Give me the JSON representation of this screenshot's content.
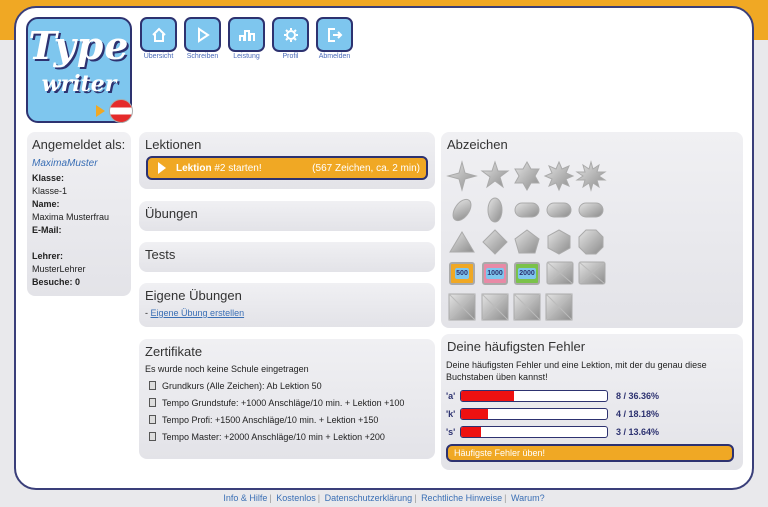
{
  "brand": {
    "line1": "Type",
    "line2": "writer"
  },
  "nav": [
    {
      "label": "Übersicht",
      "icon": "home-icon"
    },
    {
      "label": "Schreiben",
      "icon": "play-icon"
    },
    {
      "label": "Leistung",
      "icon": "chart-icon"
    },
    {
      "label": "Profil",
      "icon": "gear-icon"
    },
    {
      "label": "Abmelden",
      "icon": "logout-icon"
    }
  ],
  "sidebar": {
    "title": "Angemeldet als:",
    "username": "MaximaMuster",
    "class_label": "Klasse:",
    "class_value": "Klasse-1",
    "name_label": "Name:",
    "name_value": "Maxima Musterfrau",
    "email_label": "E-Mail:",
    "teacher_label": "Lehrer:",
    "teacher_value": "MusterLehrer",
    "visits_label": "Besuche:",
    "visits_value": "0"
  },
  "lessons": {
    "title": "Lektionen",
    "button_prefix": "Lektion",
    "button_number": "#2 starten!",
    "button_detail": "(567 Zeichen, ca. 2 min)"
  },
  "exercises": {
    "title": "Übungen"
  },
  "tests": {
    "title": "Tests"
  },
  "own_exercises": {
    "title": "Eigene Übungen",
    "dash": "-",
    "link": "Eigene Übung erstellen"
  },
  "certificates": {
    "title": "Zertifikate",
    "note": "Es wurde noch keine Schule eingetragen",
    "items": [
      "Grundkurs (Alle Zeichen): Ab Lektion 50",
      "Tempo Grundstufe: +1000 Anschläge/10 min. + Lektion +100",
      "Tempo Profi: +1500 Anschläge/10 min. + Lektion +150",
      "Tempo Master: +2000 Anschläge/10 min + Lektion +200"
    ]
  },
  "badges": {
    "title": "Abzeichen",
    "score_badges": [
      {
        "label": "500",
        "color": "#f0a824"
      },
      {
        "label": "1000",
        "color": "#e88aa6"
      },
      {
        "label": "2000",
        "color": "#7bc24a"
      }
    ]
  },
  "errors": {
    "title": "Deine häufigsten Fehler",
    "description": "Deine häufigsten Fehler und eine Lektion, mit der du genau diese Buchstaben üben kannst!",
    "rows": [
      {
        "char": "'a'",
        "count": "8 / 36.36%",
        "fraction": 0.3636
      },
      {
        "char": "'k'",
        "count": "4 / 18.18%",
        "fraction": 0.1818
      },
      {
        "char": "'s'",
        "count": "3 / 13.64%",
        "fraction": 0.1364
      }
    ],
    "button": "Häufigste Fehler üben!"
  },
  "footer": [
    "Info & Hilfe",
    "Kostenlos",
    "Datenschutzerklärung",
    "Rechtliche Hinweise",
    "Warum?"
  ],
  "colors": {
    "accent": "#f0a824",
    "navy": "#2d3270",
    "light_blue": "#7ec6ee",
    "error_fill": "#ee1111"
  }
}
